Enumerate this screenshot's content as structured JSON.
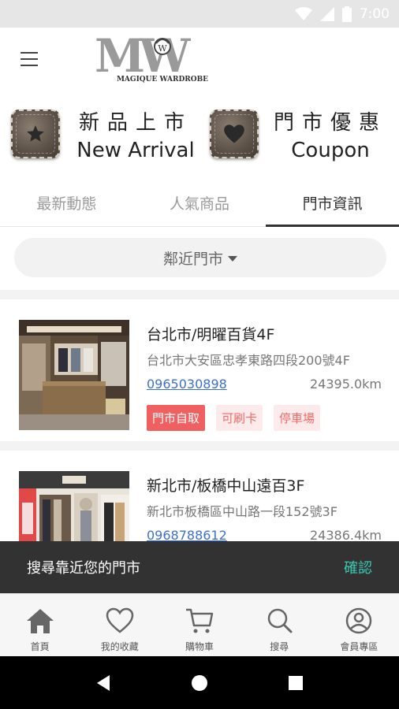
{
  "status_bar": {
    "time": "7:00"
  },
  "logo": {
    "monogram": "MW",
    "text": "MAGIQUE WARDROBE"
  },
  "promos": [
    {
      "cn": "新品上市",
      "en": "New Arrival",
      "icon": "star-icon"
    },
    {
      "cn": "門市優惠",
      "en": "Coupon",
      "icon": "heart-icon"
    }
  ],
  "tabs": [
    {
      "label": "最新動態",
      "active": false
    },
    {
      "label": "人氣商品",
      "active": false
    },
    {
      "label": "門市資訊",
      "active": true
    }
  ],
  "filter": {
    "label": "鄰近門市"
  },
  "stores": [
    {
      "name": "台北市/明曜百貨4F",
      "address": "台北市大安區忠孝東路四段200號4F",
      "phone": "0965030898",
      "distance": "24395.0km",
      "tags": [
        "門市自取",
        "可刷卡",
        "停車場"
      ]
    },
    {
      "name": "新北市/板橋中山遠百3F",
      "address": "新北市板橋區中山路一段152號3F",
      "phone": "0968788612",
      "distance": "24386.4km",
      "tags": []
    }
  ],
  "snackbar": {
    "message": "搜尋靠近您的門市",
    "action": "確認"
  },
  "bottom_nav": [
    {
      "label": "首頁",
      "icon": "home-icon"
    },
    {
      "label": "我的收藏",
      "icon": "heart-outline-icon"
    },
    {
      "label": "購物車",
      "icon": "cart-icon"
    },
    {
      "label": "搜尋",
      "icon": "search-icon"
    },
    {
      "label": "會員專區",
      "icon": "account-icon"
    }
  ],
  "colors": {
    "accent_teal": "#3cc8b4",
    "tag_red": "#f06060",
    "link_blue": "#3b6fd1"
  }
}
